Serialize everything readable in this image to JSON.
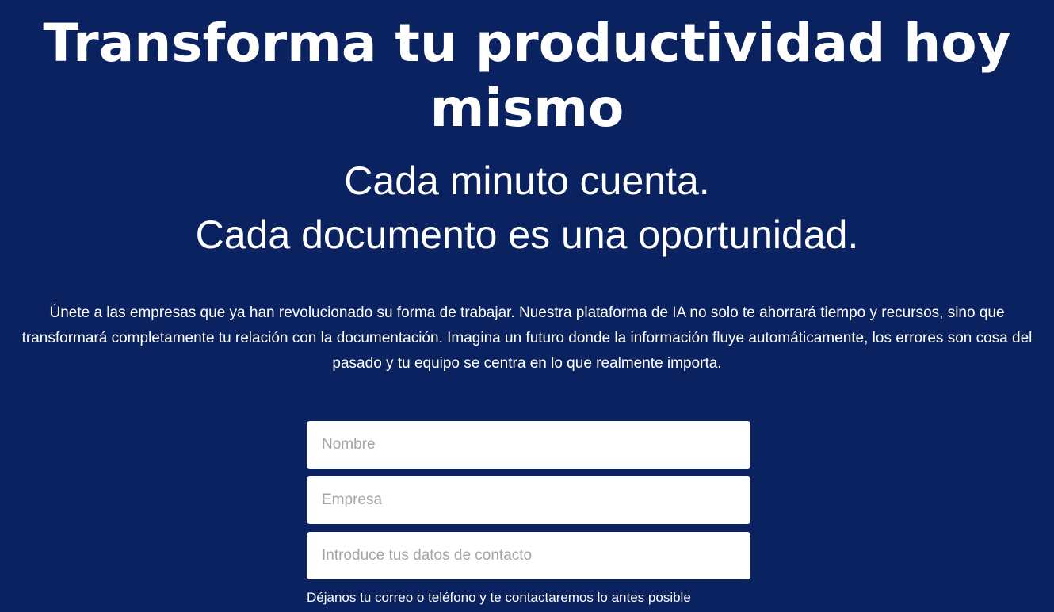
{
  "hero": {
    "headline": "Transforma tu productividad hoy mismo",
    "tagline_line1": "Cada minuto cuenta.",
    "tagline_line2": "Cada documento es una oportunidad.",
    "body": "Únete a las empresas que ya han revolucionado su forma de trabajar. Nuestra plataforma de IA no solo te ahorrará tiempo y recursos, sino que transformará completamente tu relación con la documentación. Imagina un futuro donde la información fluye automáticamente, los errores son cosa del pasado y tu equipo se centra en lo que realmente importa."
  },
  "form": {
    "name_placeholder": "Nombre",
    "company_placeholder": "Empresa",
    "contact_placeholder": "Introduce tus datos de contacto",
    "contact_hint": "Déjanos tu correo o teléfono y te contactaremos lo antes posible"
  },
  "colors": {
    "background": "#0a2260",
    "text": "#ffffff",
    "field_background": "#ffffff",
    "placeholder": "#a4a4a9"
  }
}
